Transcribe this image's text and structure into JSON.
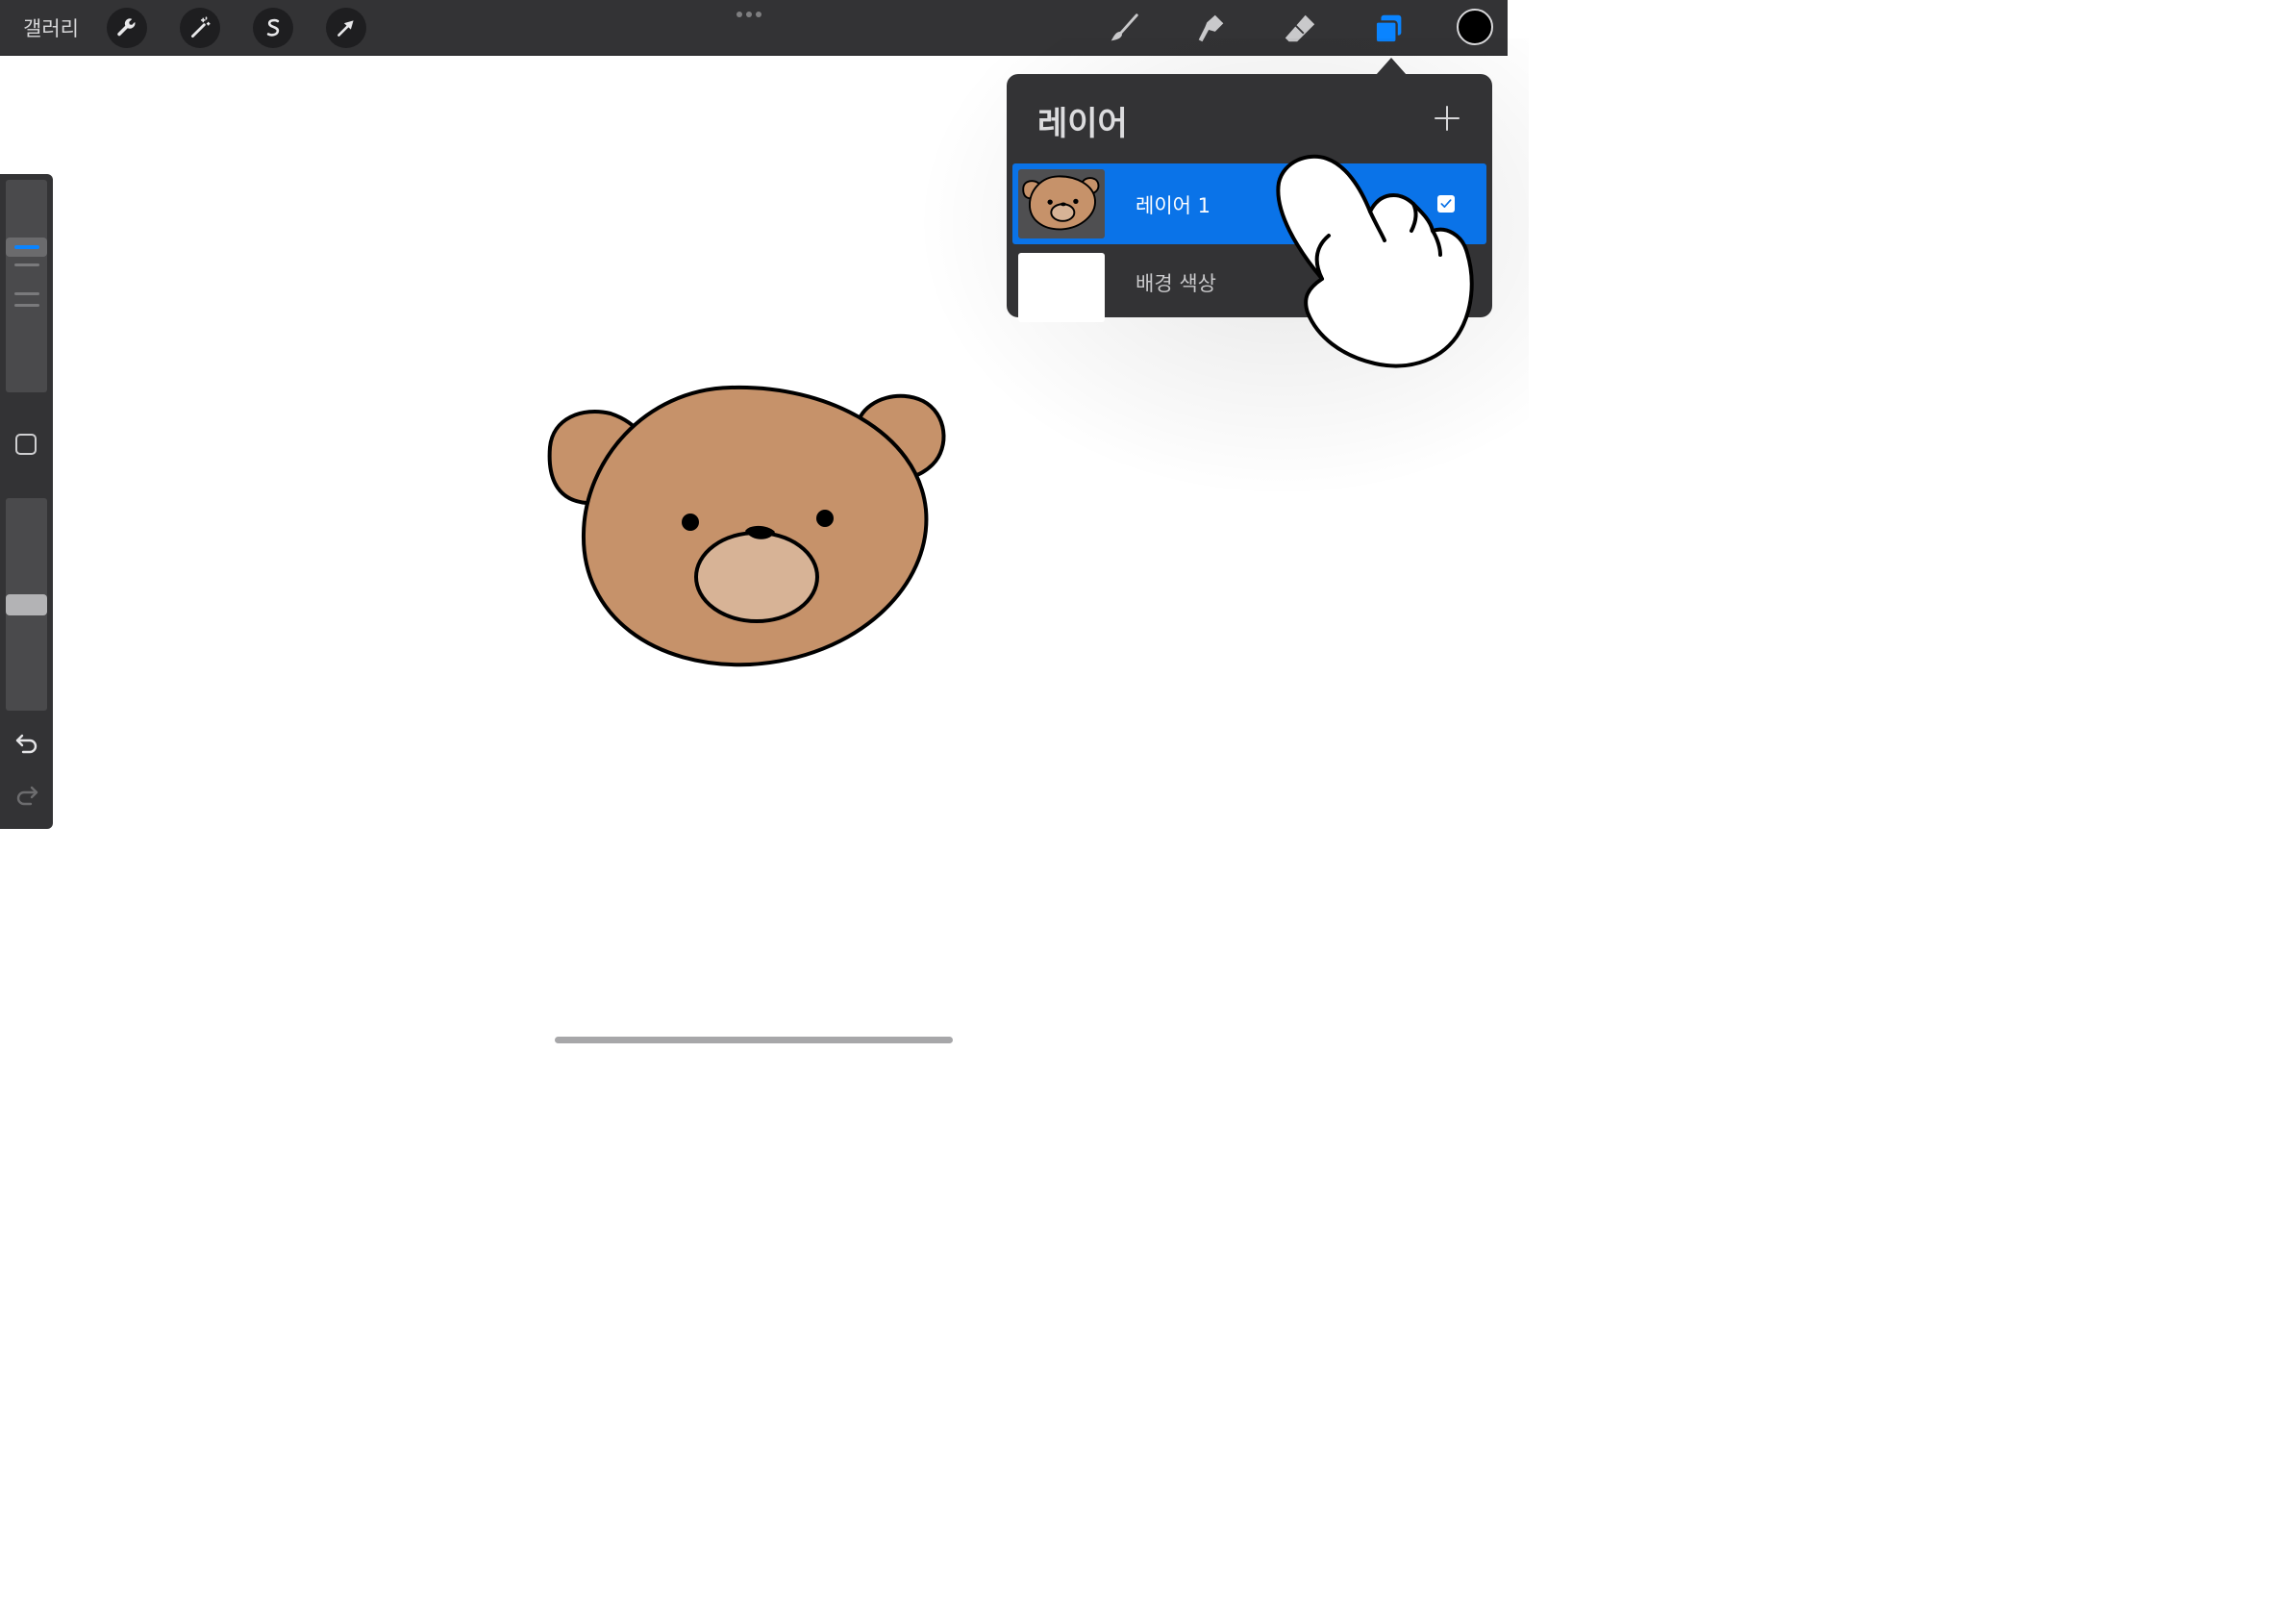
{
  "topbar": {
    "gallery_label": "갤러리",
    "left_tools": [
      {
        "icon": "wrench-icon",
        "name": "actions"
      },
      {
        "icon": "magic-wand-icon",
        "name": "adjustments"
      },
      {
        "icon": "selection-s-icon",
        "name": "selection"
      },
      {
        "icon": "arrow-cursor-icon",
        "name": "transform"
      }
    ],
    "right_tools": [
      {
        "icon": "brush-icon",
        "name": "paint"
      },
      {
        "icon": "smudge-icon",
        "name": "smudge"
      },
      {
        "icon": "eraser-icon",
        "name": "erase"
      },
      {
        "icon": "layers-icon",
        "name": "layers",
        "active": true
      }
    ],
    "current_color": "#000000",
    "accent_color": "#0a84ff"
  },
  "sidebar": {
    "brush_size_level": 0.7,
    "opacity_level": 0.5,
    "modify_icon": "square-icon",
    "undo_icon": "undo-icon",
    "redo_icon": "redo-icon"
  },
  "layers_panel": {
    "title": "레이어",
    "add_icon": "plus-icon",
    "layers": [
      {
        "name": "레이어 1",
        "selected": true,
        "visible": true,
        "thumbnail": "bear"
      },
      {
        "name": "배경 색상",
        "selected": false,
        "thumbnail": "white"
      }
    ]
  },
  "canvas": {
    "subject": "bear-head-drawing",
    "colors": {
      "fur": "#c6926a",
      "muzzle": "#d7b396",
      "outline": "#000000"
    }
  }
}
